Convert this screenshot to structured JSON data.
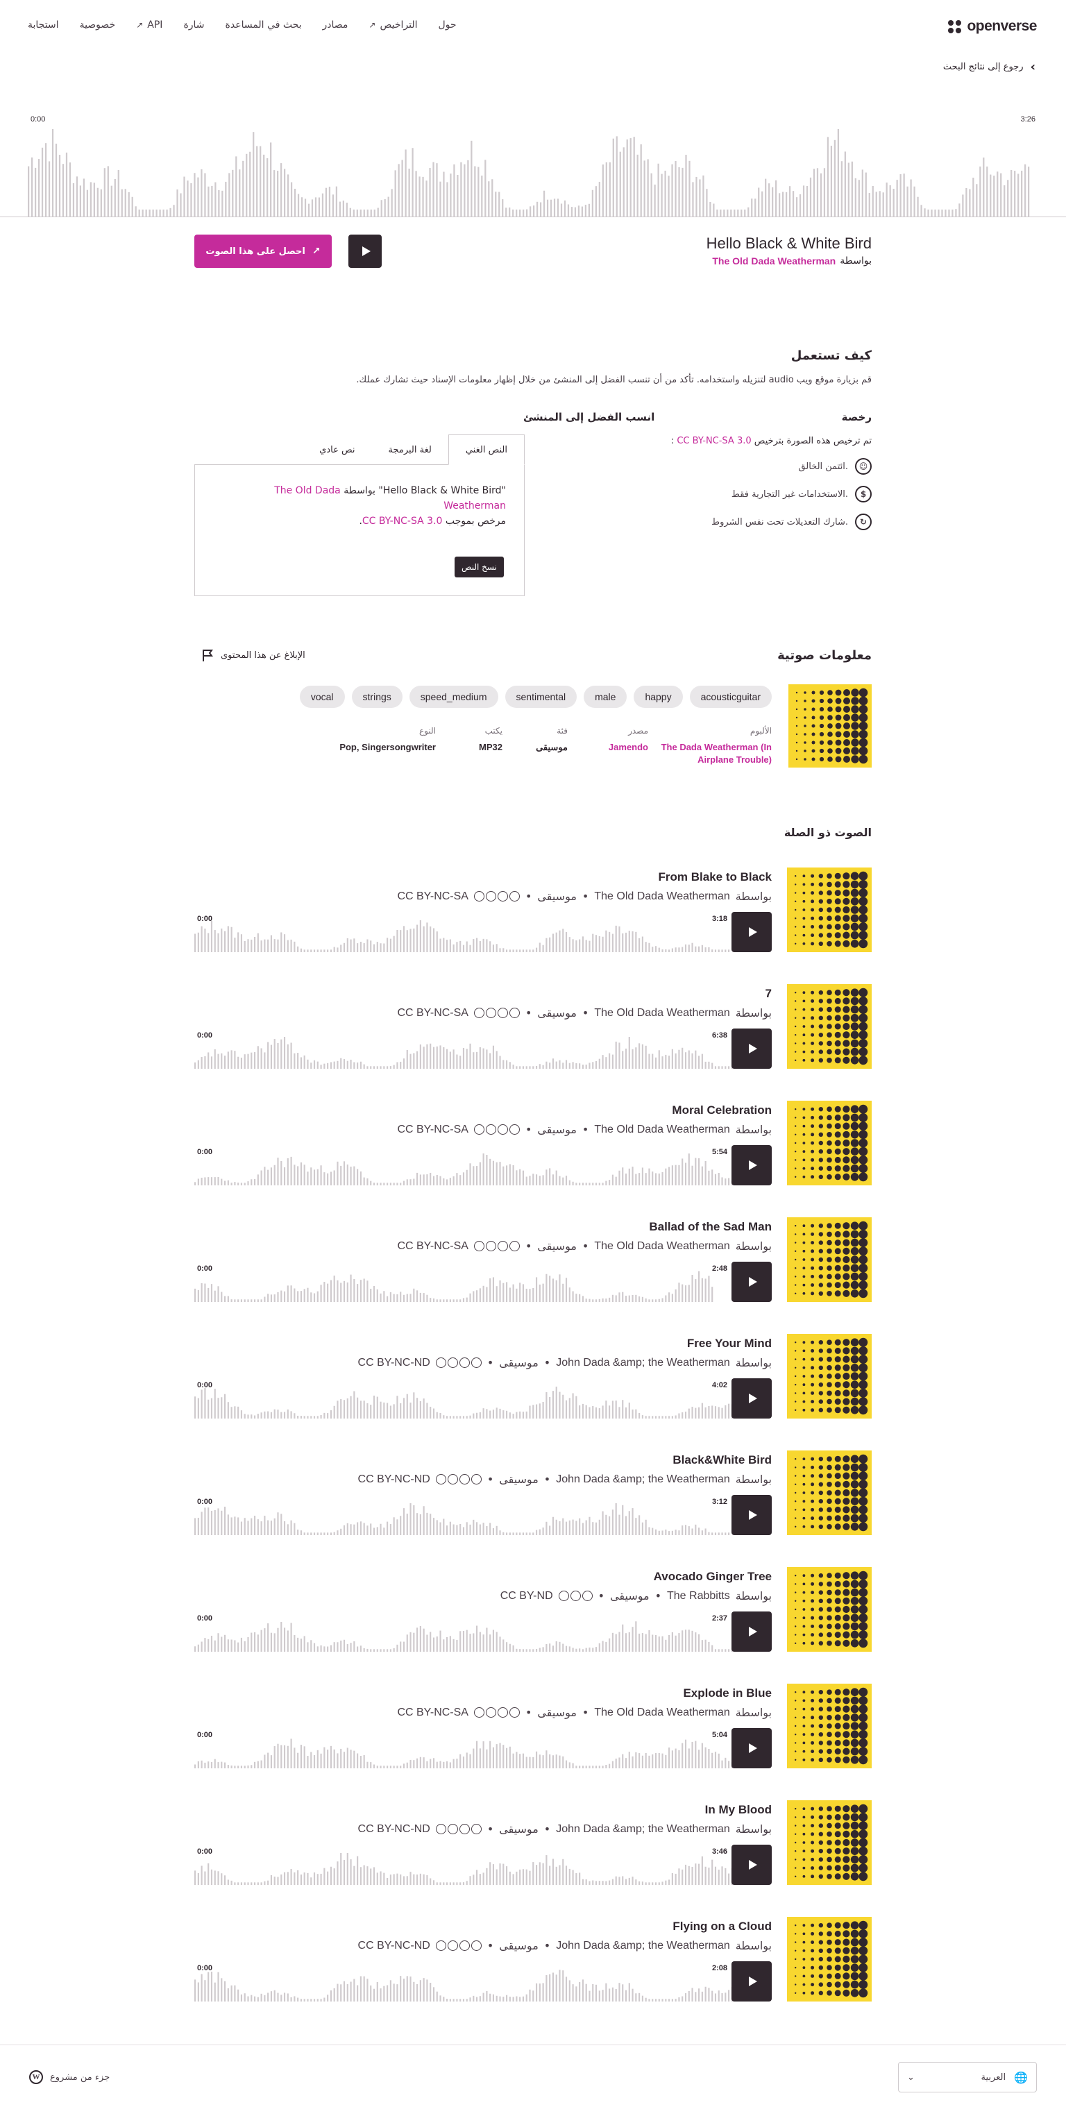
{
  "header": {
    "logo_text": "openverse",
    "nav": [
      {
        "label": "حول",
        "icon": ""
      },
      {
        "label": "التراخيص",
        "icon": "external-link-icon"
      },
      {
        "label": "مصادر",
        "icon": ""
      },
      {
        "label": "بحث في المساعدة",
        "icon": ""
      },
      {
        "label": "شارة",
        "icon": ""
      },
      {
        "label": "API",
        "icon": "external-link-icon"
      },
      {
        "label": "خصوصية",
        "icon": ""
      },
      {
        "label": "استجابة",
        "icon": ""
      }
    ]
  },
  "back_link": "رجوع إلى نتائج البحث",
  "player": {
    "time_start": "0:00",
    "time_end": "3:26"
  },
  "track": {
    "title": "Hello Black & White Bird",
    "by": "بواسطة",
    "creator": "The Old Dada Weatherman",
    "get_button": "احصل على هذا الصوت"
  },
  "how_to_use": {
    "title": "كيف تستعمل",
    "description": "قم بزيارة موقع ويب audio لتنزيله واستخدامه. تأكد من أن تنسب الفضل إلى المنشئ من خلال إظهار معلومات الإسناد حيث تشارك عملك.",
    "license_title": "رخصة",
    "license_text": "تم ترخيص هذه الصورة بترخيص",
    "license_name": "CC BY-NC-SA 3.0",
    "license_items": [
      {
        "icon": "cc-by-icon",
        "text": "ائتمن الخالق."
      },
      {
        "icon": "cc-nc-icon",
        "text": "الاستخدامات غير التجارية فقط."
      },
      {
        "icon": "cc-sa-icon",
        "text": "شارك التعديلات تحت نفس الشروط."
      }
    ],
    "attribution_title": "انسب الفضل إلى المنشئ",
    "tabs": [
      "النص الغني",
      "لغة البرمجة",
      "نص عادي"
    ],
    "attr_title_quoted": "\"Hello Black & White Bird\"",
    "attr_by": "بواسطة",
    "attr_creator": "The Old Dada Weatherman",
    "attr_licensed": "مرخص بموجب",
    "attr_license": "CC BY-NC-SA 3.0",
    "copy_button": "نسخ النص"
  },
  "audio_info": {
    "title": "معلومات صوتية",
    "report": "الإبلاغ عن هذا المحتوى",
    "tags": [
      "acousticguitar",
      "happy",
      "male",
      "sentimental",
      "speed_medium",
      "strings",
      "vocal"
    ],
    "meta": [
      {
        "label": "الألبوم",
        "value": "The Dada Weatherman (In Airplane Trouble)"
      },
      {
        "label": "مصدر",
        "value": "Jamendo"
      },
      {
        "label": "فئة",
        "value": "موسيقى"
      },
      {
        "label": "يكتب",
        "value": "MP32"
      },
      {
        "label": "النوع",
        "value": "Pop, Singersongwriter"
      }
    ],
    "accent_color": "#c52b9b",
    "cover_color": "#f8d730"
  },
  "related": {
    "title": "الصوت ذو الصلة",
    "by": "بواسطة",
    "category": "موسيقى",
    "time_start": "0:00",
    "items": [
      {
        "title": "From Blake to Black",
        "creator": "The Old Dada Weatherman",
        "license": "CC BY-NC-SA",
        "duration": "3:18",
        "progress": 0.95
      },
      {
        "title": "7",
        "creator": "The Old Dada Weatherman",
        "license": "CC BY-NC-SA",
        "duration": "6:38",
        "progress": 1.0
      },
      {
        "title": "Moral Celebration",
        "creator": "The Old Dada Weatherman",
        "license": "CC BY-NC-SA",
        "duration": "5:54",
        "progress": 1.0
      },
      {
        "title": "Ballad of the Sad Man",
        "creator": "The Old Dada Weatherman",
        "license": "CC BY-NC-SA",
        "duration": "2:48",
        "progress": 0.92
      },
      {
        "title": "Free Your Mind",
        "creator": "John Dada &amp; the Weatherman",
        "license": "CC BY-NC-ND",
        "duration": "4:02",
        "progress": 1.0
      },
      {
        "title": "Black&White Bird",
        "creator": "John Dada &amp; the Weatherman",
        "license": "CC BY-NC-ND",
        "duration": "3:12",
        "progress": 0.95
      },
      {
        "title": "Avocado Ginger Tree",
        "creator": "The Rabbitts",
        "license": "CC BY-ND",
        "duration": "2:37",
        "progress": 1.0
      },
      {
        "title": "Explode in Blue",
        "creator": "The Old Dada Weatherman",
        "license": "CC BY-NC-SA",
        "duration": "5:04",
        "progress": 1.0
      },
      {
        "title": "In My Blood",
        "creator": "John Dada &amp; the Weatherman",
        "license": "CC BY-NC-ND",
        "duration": "3:46",
        "progress": 1.0
      },
      {
        "title": "Flying on a Cloud",
        "creator": "John Dada &amp; the Weatherman",
        "license": "CC BY-NC-ND",
        "duration": "2:08",
        "progress": 1.0
      }
    ]
  },
  "footer": {
    "language": "العربية",
    "wordpress": "جزء من مشروع"
  }
}
